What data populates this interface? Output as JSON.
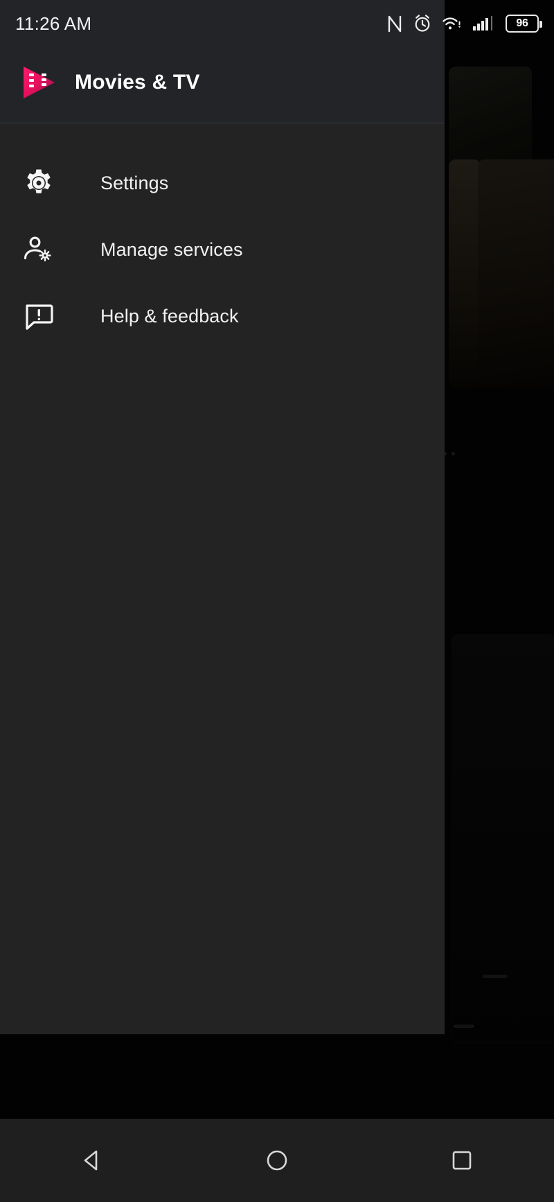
{
  "status_bar": {
    "clock": "11:26 AM",
    "icons": [
      {
        "name": "nfc-icon",
        "glyph": "N"
      },
      {
        "name": "alarm-icon",
        "glyph": "alarm"
      },
      {
        "name": "wifi-icon",
        "glyph": "wifi"
      },
      {
        "name": "cellular-signal-icon",
        "glyph": "signal"
      }
    ],
    "battery_level": "96"
  },
  "drawer": {
    "app_logo_name": "play-movies-logo",
    "app_title": "Movies & TV",
    "menu_items": [
      {
        "icon": "gear-icon",
        "label": "Settings"
      },
      {
        "icon": "manage-accounts-icon",
        "label": "Manage services"
      },
      {
        "icon": "feedback-icon",
        "label": "Help & feedback"
      }
    ]
  },
  "nav_bar": {
    "buttons": [
      {
        "name": "back-button",
        "icon": "back-triangle-icon"
      },
      {
        "name": "home-button",
        "icon": "home-circle-icon"
      },
      {
        "name": "recents-button",
        "icon": "recents-square-icon"
      }
    ]
  },
  "colors": {
    "drawer_bg": "#232323",
    "header_bg": "#222427",
    "accent_magenta": "#E0156C",
    "accent_crimson": "#C2185B",
    "text_primary": "#F1F1F1",
    "nav_bg": "#1F1F1F"
  }
}
